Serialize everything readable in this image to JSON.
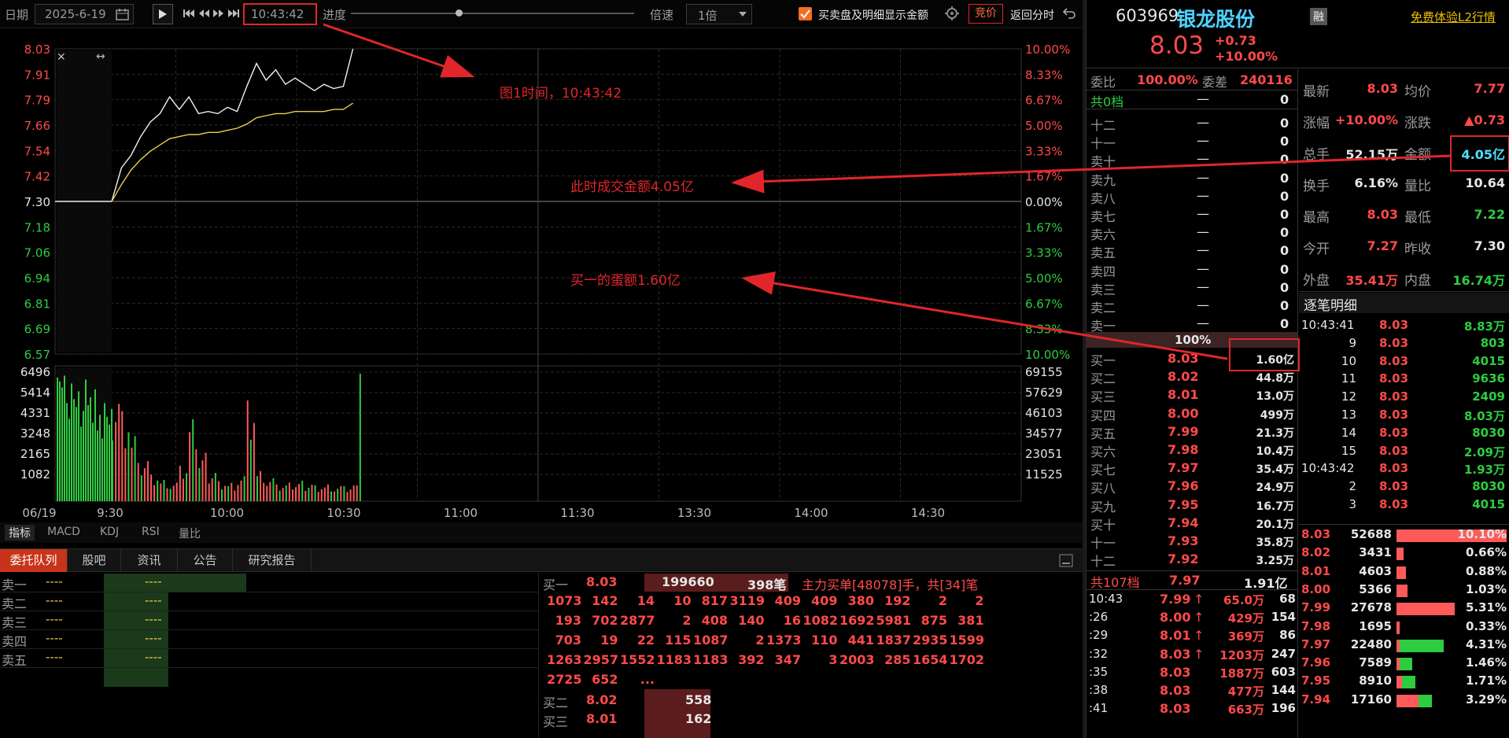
{
  "toolbar": {
    "date_label": "日期",
    "date_value": "2025-6-19",
    "time_value": "10:43:42",
    "progress_label": "进度",
    "speed_label": "倍速",
    "speed_value": "1倍",
    "checkbox_label": "买卖盘及明细显示金额",
    "auction_label": "竞价",
    "return_label": "返回分时",
    "progress_value": 0.38
  },
  "stock": {
    "code": "603969",
    "name": "银龙股份",
    "price": "8.03",
    "change": "+0.73",
    "change_pct": "+10.00%",
    "margin_badge": "融",
    "l2_link": "免费体验L2行情"
  },
  "annotations": {
    "a1": "图1时间，10:43:42",
    "a2": "此时成交金额4.05亿",
    "a3": "买一的蛋额1.60亿"
  },
  "chart_data": {
    "type": "line",
    "x": [
      "09:30",
      "09:33",
      "09:36",
      "09:39",
      "09:42",
      "09:45",
      "09:48",
      "09:51",
      "09:54",
      "09:57",
      "10:00",
      "10:03",
      "10:06",
      "10:09",
      "10:12",
      "10:15",
      "10:18",
      "10:21",
      "10:24",
      "10:27",
      "10:30",
      "10:33",
      "10:36",
      "10:39",
      "10:42",
      "10:43"
    ],
    "series": [
      {
        "values": [
          7.3,
          7.46,
          7.52,
          7.61,
          7.68,
          7.72,
          7.8,
          7.74,
          7.8,
          7.72,
          7.73,
          7.72,
          7.75,
          7.73,
          7.85,
          7.96,
          7.88,
          7.93,
          7.86,
          7.89,
          7.86,
          7.83,
          7.86,
          7.84,
          7.85,
          8.03
        ]
      },
      {
        "values": [
          7.3,
          7.38,
          7.45,
          7.5,
          7.54,
          7.57,
          7.6,
          7.61,
          7.62,
          7.62,
          7.63,
          7.63,
          7.64,
          7.65,
          7.67,
          7.7,
          7.71,
          7.72,
          7.72,
          7.73,
          7.73,
          7.73,
          7.73,
          7.74,
          7.74,
          7.77
        ]
      }
    ],
    "price_ticks": [
      "8.03",
      "7.91",
      "7.79",
      "7.66",
      "7.54",
      "7.42",
      "7.30",
      "7.18",
      "7.06",
      "6.94",
      "6.81",
      "6.69",
      "6.57"
    ],
    "pct_ticks": [
      "10.00%",
      "8.33%",
      "6.67%",
      "5.00%",
      "3.33%",
      "1.67%",
      "0.00%",
      "1.67%",
      "3.33%",
      "5.00%",
      "6.67%",
      "8.33%",
      "10.00%"
    ],
    "ylim": [
      6.57,
      8.03
    ],
    "vol_ticks_left": [
      "6496",
      "5414",
      "4331",
      "3248",
      "2165",
      "1082"
    ],
    "vol_ticks_right": [
      "69155",
      "57629",
      "46103",
      "34577",
      "23051",
      "11525"
    ],
    "time_ticks": [
      "06/19",
      "9:30",
      "10:00",
      "10:30",
      "11:00",
      "11:30",
      "13:30",
      "14:00",
      "14:30"
    ],
    "volume": [
      6200,
      5400,
      3900,
      2400,
      1500,
      1200,
      1050,
      1900,
      4400,
      2600,
      1800,
      1200,
      1100,
      1500,
      5700,
      1700,
      1300,
      900,
      1000,
      1100,
      1050,
      950,
      1000,
      900,
      850,
      6496
    ]
  },
  "indicator_tabs": [
    "指标",
    "MACD",
    "KDJ",
    "RSI",
    "量比"
  ],
  "bottom_tabs": [
    "委托队列",
    "股吧",
    "资讯",
    "公告",
    "研究报告"
  ],
  "queue_rows": [
    {
      "label": "卖一",
      "a": "----",
      "b": "----"
    },
    {
      "label": "卖二",
      "a": "----",
      "b": "----"
    },
    {
      "label": "卖三",
      "a": "----",
      "b": "----"
    },
    {
      "label": "卖四",
      "a": "----",
      "b": "----"
    },
    {
      "label": "卖五",
      "a": "----",
      "b": "----"
    }
  ],
  "buy_queue": {
    "label": "买一",
    "price": "8.03",
    "qty": "199660",
    "count": "398笔",
    "main_text": "主力买单[48078]手，共[34]笔",
    "rows": [
      [
        "1073",
        "142",
        "14",
        "10",
        "817",
        "3119",
        "409",
        "409",
        "380",
        "192",
        "2",
        "2"
      ],
      [
        "193",
        "702",
        "2877",
        "2",
        "408",
        "140",
        "16",
        "1082",
        "1692",
        "5981",
        "875",
        "381"
      ],
      [
        "703",
        "19",
        "22",
        "115",
        "1087",
        "2",
        "1373",
        "110",
        "441",
        "1837",
        "2935",
        "1599"
      ],
      [
        "1263",
        "2957",
        "1552",
        "1183",
        "1183",
        "392",
        "347",
        "3",
        "2003",
        "285",
        "1654",
        "1702"
      ],
      [
        "2725",
        "652",
        "..."
      ]
    ],
    "b2_label": "买二",
    "b2_price": "8.02",
    "b2_qty": "558",
    "b3_label": "买三",
    "b3_price": "8.01",
    "b3_qty": "162"
  },
  "orderbook": {
    "wb_label": "委比",
    "wb_value": "100.00%",
    "wc_label": "委差",
    "wc_value": "240116",
    "sell_total": "共0档",
    "sell_total_dash": "—",
    "sell_total_val": "0",
    "sells": [
      [
        "十二",
        "—",
        "0"
      ],
      [
        "十一",
        "—",
        "0"
      ],
      [
        "卖十",
        "—",
        "0"
      ],
      [
        "卖九",
        "—",
        "0"
      ],
      [
        "卖八",
        "—",
        "0"
      ],
      [
        "卖七",
        "—",
        "0"
      ],
      [
        "卖六",
        "—",
        "0"
      ],
      [
        "卖五",
        "—",
        "0"
      ],
      [
        "卖四",
        "—",
        "0"
      ],
      [
        "卖三",
        "—",
        "0"
      ],
      [
        "卖二",
        "—",
        "0"
      ],
      [
        "卖一",
        "—",
        "0"
      ]
    ],
    "mid": "100%",
    "buys": [
      [
        "买一",
        "8.03",
        "1.60亿"
      ],
      [
        "买二",
        "8.02",
        "44.8万"
      ],
      [
        "买三",
        "8.01",
        "13.0万"
      ],
      [
        "买四",
        "8.00",
        "499万"
      ],
      [
        "买五",
        "7.99",
        "21.3万"
      ],
      [
        "买六",
        "7.98",
        "10.4万"
      ],
      [
        "买七",
        "7.97",
        "35.4万"
      ],
      [
        "买八",
        "7.96",
        "24.9万"
      ],
      [
        "买九",
        "7.95",
        "16.7万"
      ],
      [
        "买十",
        "7.94",
        "20.1万"
      ],
      [
        "十一",
        "7.93",
        "35.8万"
      ],
      [
        "十二",
        "7.92",
        "3.25万"
      ]
    ],
    "buy_total": "共107档",
    "buy_total_price": "7.97",
    "buy_total_val": "1.91亿"
  },
  "trades_min": [
    [
      "10:43",
      "7.99",
      "↑",
      "65.0万",
      "68"
    ],
    [
      ":26",
      "8.00",
      "↑",
      "429万",
      "154"
    ],
    [
      ":29",
      "8.01",
      "↑",
      "369万",
      "86"
    ],
    [
      ":32",
      "8.03",
      "↑",
      "1203万",
      "247"
    ],
    [
      ":35",
      "8.03",
      "",
      "1887万",
      "603"
    ],
    [
      ":38",
      "8.03",
      "",
      "477万",
      "144"
    ],
    [
      ":41",
      "8.03",
      "",
      "663万",
      "196"
    ]
  ],
  "quote": [
    {
      "l1": "最新",
      "v1": "8.03",
      "l2": "均价",
      "v2": "7.77"
    },
    {
      "l1": "涨幅",
      "v1": "+10.00%",
      "l2": "涨跌",
      "v2": "▲0.73"
    },
    {
      "l1": "总手",
      "v1": "52.15万",
      "l2": "金额",
      "v2": "4.05亿"
    },
    {
      "l1": "换手",
      "v1": "6.16%",
      "l2": "量比",
      "v2": "10.64"
    },
    {
      "l1": "最高",
      "v1": "8.03",
      "l2": "最低",
      "v2": "7.22"
    },
    {
      "l1": "今开",
      "v1": "7.27",
      "l2": "昨收",
      "v2": "7.30"
    },
    {
      "l1": "外盘",
      "v1": "35.41万",
      "l2": "内盘",
      "v2": "16.74万"
    }
  ],
  "tick_title": "逐笔明细",
  "ticks": [
    [
      "10:43:41",
      "8.03",
      "8.83万"
    ],
    [
      "9",
      "8.03",
      "803"
    ],
    [
      "10",
      "8.03",
      "4015"
    ],
    [
      "11",
      "8.03",
      "9636"
    ],
    [
      "12",
      "8.03",
      "2409"
    ],
    [
      "13",
      "8.03",
      "8.03万"
    ],
    [
      "14",
      "8.03",
      "8030"
    ],
    [
      "15",
      "8.03",
      "2.09万"
    ],
    [
      "10:43:42",
      "8.03",
      "1.93万"
    ],
    [
      "2",
      "8.03",
      "8030"
    ],
    [
      "3",
      "8.03",
      "4015"
    ]
  ],
  "dist": [
    {
      "p": "8.03",
      "v": "52688",
      "pct": "10.10%",
      "r": 1.0,
      "g": 0
    },
    {
      "p": "8.02",
      "v": "3431",
      "pct": "0.66%",
      "r": 0.065,
      "g": 0
    },
    {
      "p": "8.01",
      "v": "4603",
      "pct": "0.88%",
      "r": 0.088,
      "g": 0
    },
    {
      "p": "8.00",
      "v": "5366",
      "pct": "1.03%",
      "r": 0.1,
      "g": 0
    },
    {
      "p": "7.99",
      "v": "27678",
      "pct": "5.31%",
      "r": 0.525,
      "g": 0
    },
    {
      "p": "7.98",
      "v": "1695",
      "pct": "0.33%",
      "r": 0.03,
      "g": 0
    },
    {
      "p": "7.97",
      "v": "22480",
      "pct": "4.31%",
      "r": 0.03,
      "g": 0.4
    },
    {
      "p": "7.96",
      "v": "7589",
      "pct": "1.46%",
      "r": 0.03,
      "g": 0.11
    },
    {
      "p": "7.95",
      "v": "8910",
      "pct": "1.71%",
      "r": 0.05,
      "g": 0.12
    },
    {
      "p": "7.94",
      "v": "17160",
      "pct": "3.29%",
      "r": 0.2,
      "g": 0.12
    }
  ]
}
